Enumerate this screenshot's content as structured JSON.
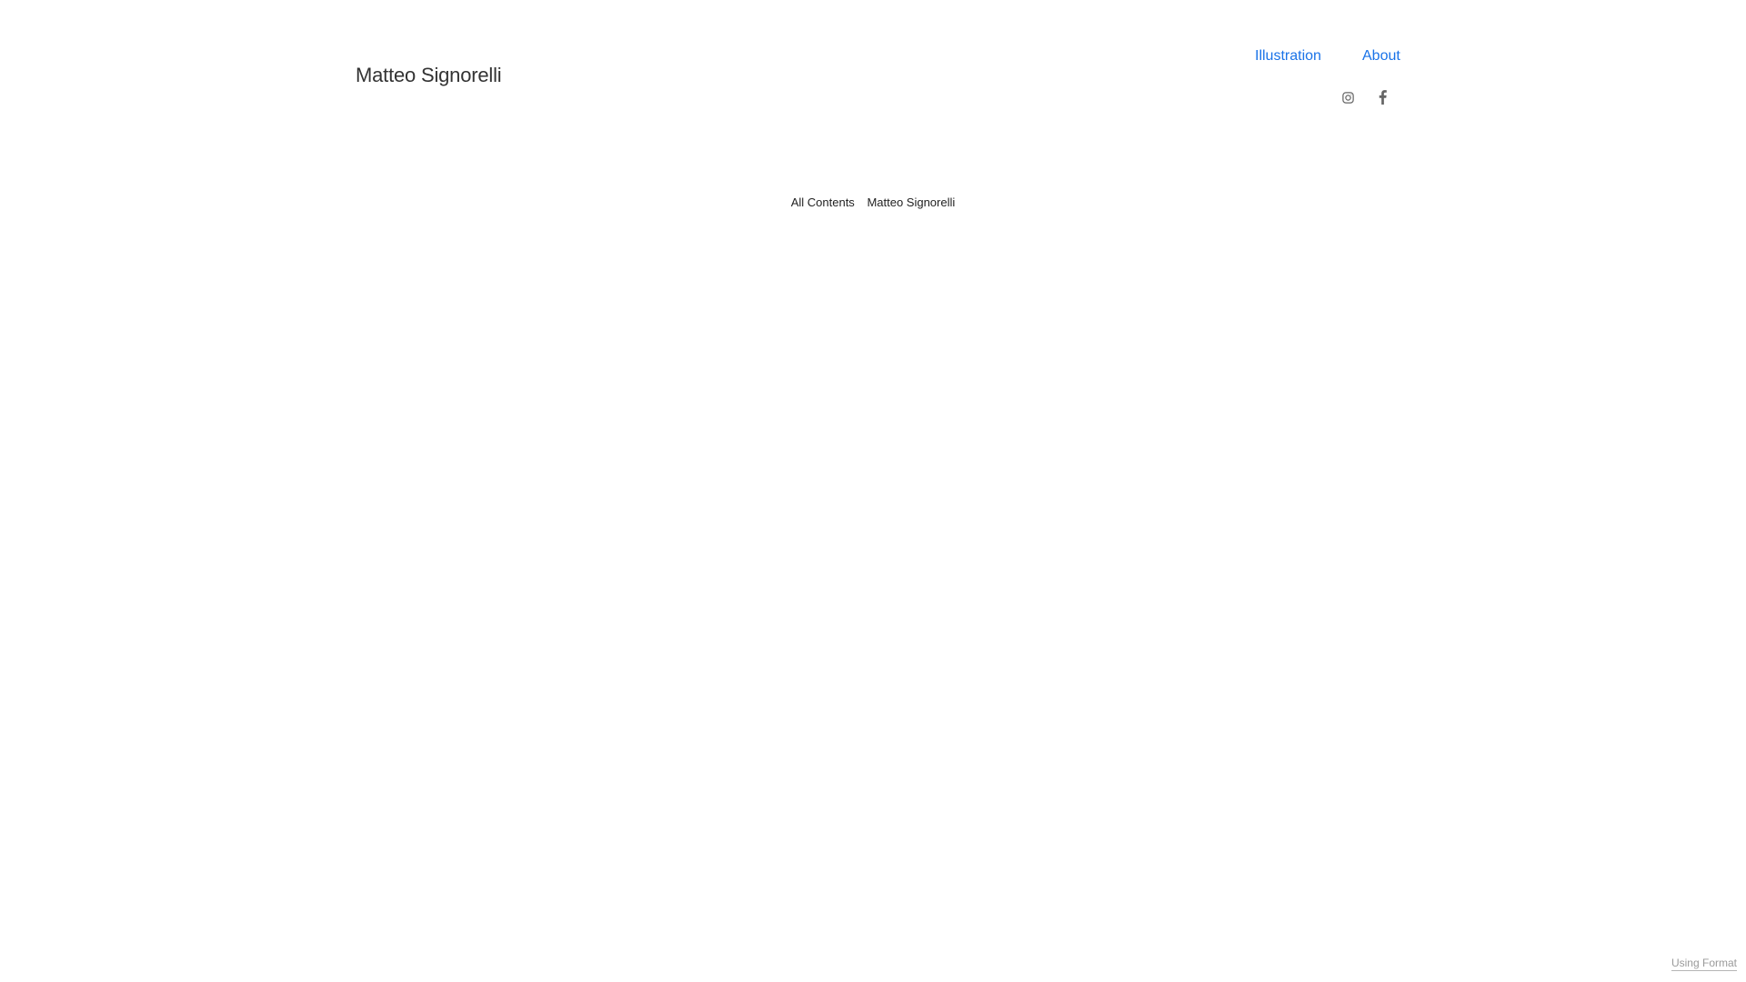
{
  "header": {
    "site_title": "Matteo Signorelli"
  },
  "nav": {
    "items": [
      {
        "label": "Illustration"
      },
      {
        "label": "About"
      }
    ],
    "link_color": "#1a73e8"
  },
  "social": {
    "icons": [
      "instagram-icon",
      "facebook-icon"
    ],
    "icon_color": "#666666"
  },
  "footer": {
    "copyright_label": "All Contents",
    "copyright_owner": "Matteo Signorelli"
  },
  "badge": {
    "label": "Using Format"
  }
}
